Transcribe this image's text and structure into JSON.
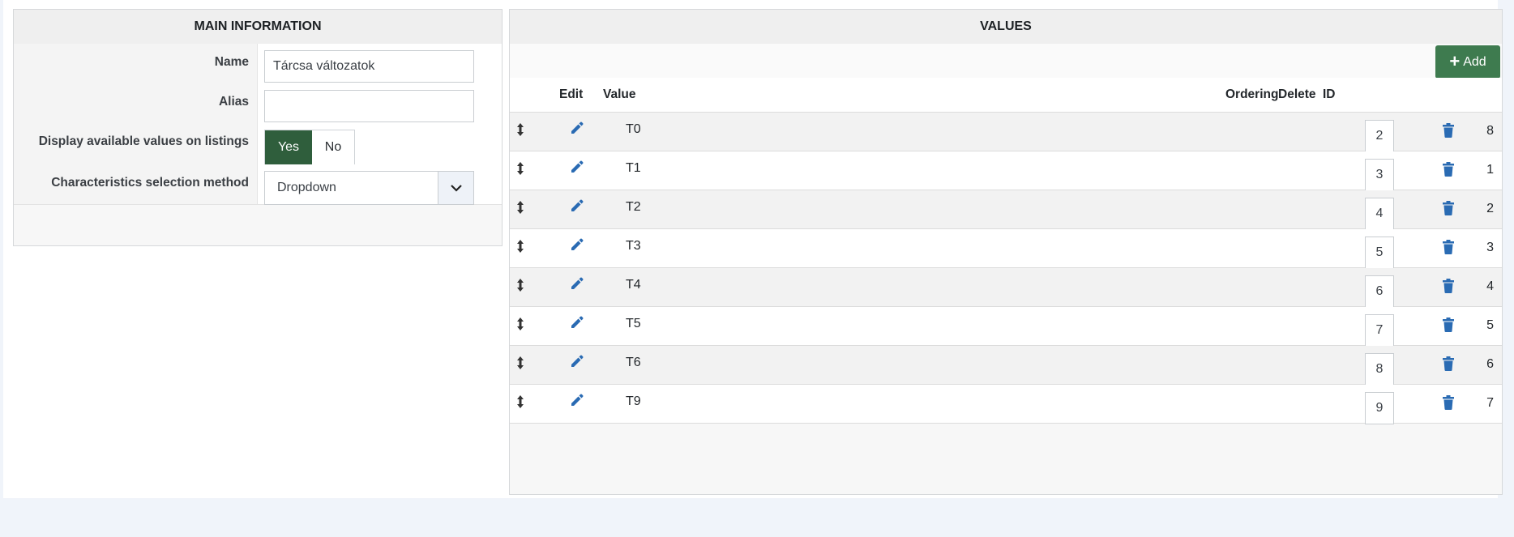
{
  "main_info": {
    "title": "MAIN INFORMATION",
    "name_label": "Name",
    "name_value": "Tárcsa változatok",
    "alias_label": "Alias",
    "alias_value": "",
    "display_label": "Display available values on listings",
    "display_yes": "Yes",
    "display_no": "No",
    "display_selected": "Yes",
    "method_label": "Characteristics selection method",
    "method_value": "Dropdown"
  },
  "values": {
    "title": "VALUES",
    "add_label": "Add",
    "columns": {
      "edit": "Edit",
      "value": "Value",
      "ordering": "Ordering",
      "delete": "Delete",
      "id": "ID"
    },
    "rows": [
      {
        "value": "T0",
        "ordering": "2",
        "id": "8"
      },
      {
        "value": "T1",
        "ordering": "3",
        "id": "1"
      },
      {
        "value": "T2",
        "ordering": "4",
        "id": "2"
      },
      {
        "value": "T3",
        "ordering": "5",
        "id": "3"
      },
      {
        "value": "T4",
        "ordering": "6",
        "id": "4"
      },
      {
        "value": "T5",
        "ordering": "7",
        "id": "5"
      },
      {
        "value": "T6",
        "ordering": "8",
        "id": "6"
      },
      {
        "value": "T9",
        "ordering": "9",
        "id": "7"
      }
    ]
  },
  "icons": {
    "drag": "sort-handle-icon",
    "edit": "pencil-icon",
    "delete": "trash-icon",
    "add": "plus-icon",
    "dropdown": "chevron-down-icon"
  },
  "colors": {
    "toggle_on": "#2f5e3c",
    "add_button": "#3e7b4f",
    "action_icons": "#2a6bb3"
  }
}
